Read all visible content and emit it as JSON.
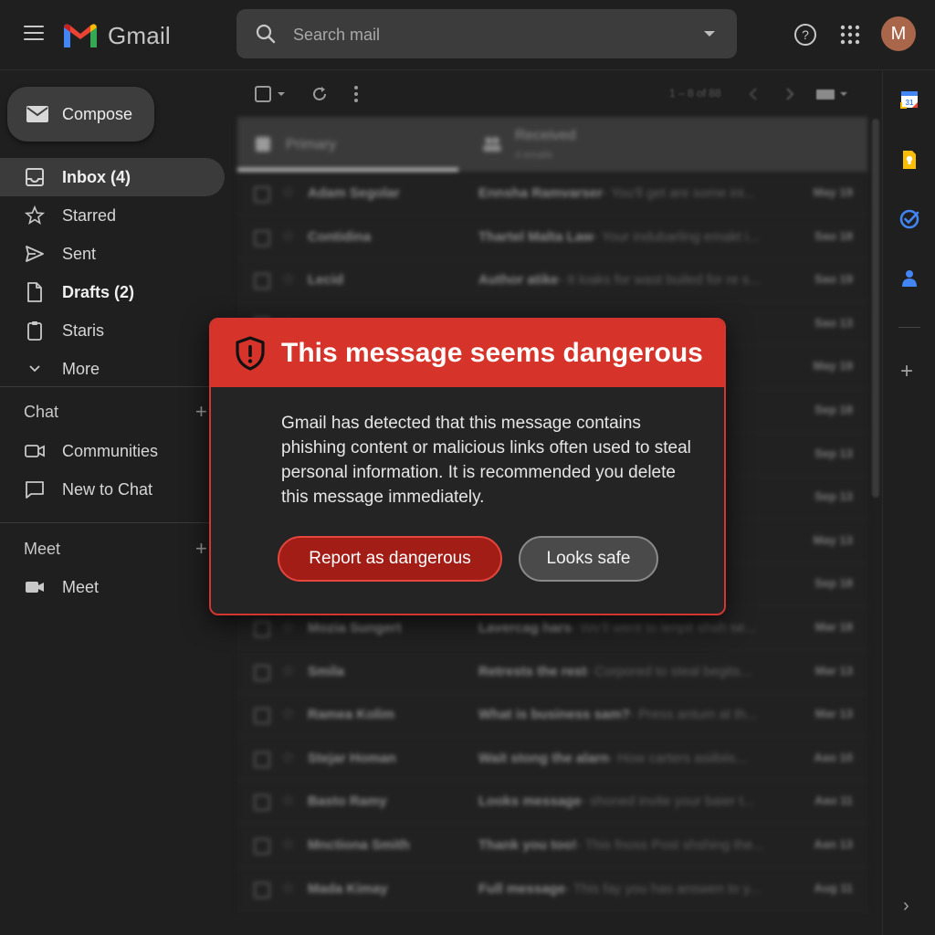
{
  "header": {
    "app_name": "Gmail",
    "search_placeholder": "Search mail",
    "avatar_initial": "M"
  },
  "sidebar": {
    "compose_label": "Compose",
    "items": [
      {
        "label": "Inbox (4)",
        "icon": "inbox-icon",
        "active": true,
        "bold": true
      },
      {
        "label": "Starred",
        "icon": "star-icon"
      },
      {
        "label": "Sent",
        "icon": "send-icon"
      },
      {
        "label": "Drafts (2)",
        "icon": "draft-icon",
        "bold": true
      },
      {
        "label": "Staris",
        "icon": "clipboard-icon"
      },
      {
        "label": "More",
        "icon": "chevron-down-icon"
      }
    ],
    "chat_title": "Chat",
    "chat_items": [
      {
        "label": "Communities",
        "icon": "video-icon"
      },
      {
        "label": "New to Chat",
        "icon": "chat-bubble-icon"
      }
    ],
    "meet_title": "Meet",
    "meet_items": [
      {
        "label": "Meet",
        "icon": "camera-icon"
      }
    ]
  },
  "toolbar": {
    "pager": "1 – 8 of 88"
  },
  "tabs": {
    "primary_label": "Primary",
    "received_label": "Received",
    "received_sub": "4 emails"
  },
  "emails": [
    {
      "sender": "Adam Segolar",
      "subject": "Ennsha Ramvarser",
      "snippet": " - You'll get are some ini...",
      "date": "May 19"
    },
    {
      "sender": "Contidina",
      "subject": "Thartel Malta Law",
      "snippet": " - Your indubarling emakt i...",
      "date": "Sao 18"
    },
    {
      "sender": "Lecid",
      "subject": "Author atike",
      "snippet": " - It loaks for wast builed for re s...",
      "date": "Sao 19"
    },
    {
      "sender": "",
      "subject": "",
      "snippet": "",
      "date": "Sao 13"
    },
    {
      "sender": "",
      "subject": "",
      "snippet": "",
      "date": "May 19"
    },
    {
      "sender": "",
      "subject": "",
      "snippet": "",
      "date": "Sep 18"
    },
    {
      "sender": "",
      "subject": "",
      "snippet": "",
      "date": "Sep 13"
    },
    {
      "sender": "",
      "subject": "",
      "snippet": "",
      "date": "Sep 13"
    },
    {
      "sender": "",
      "subject": "",
      "snippet": "",
      "date": "May 13"
    },
    {
      "sender": "",
      "subject": "",
      "snippet": "",
      "date": "Sep 18"
    },
    {
      "sender": "Mozia Sungert",
      "subject": "Lavercag hars",
      "snippet": " - We'll went to lenpit shsh se...",
      "date": "Mar 18"
    },
    {
      "sender": "Smila",
      "subject": "Retrests the rest",
      "snippet": " - Corpored to steal begits...",
      "date": "Mar 13"
    },
    {
      "sender": "Ramea Kolim",
      "subject": "What is business sam?",
      "snippet": " - Press antum at th...",
      "date": "Mar 13"
    },
    {
      "sender": "Stejar Homan",
      "subject": "Wait stong the alarn",
      "snippet": " - How carters asiibiis...",
      "date": "Aao 10"
    },
    {
      "sender": "Basto Ramy",
      "subject": "Looks message",
      "snippet": " - shoned invite your baier t...",
      "date": "Aao 11"
    },
    {
      "sender": "Mnctiona Smith",
      "subject": "Thank you too!",
      "snippet": " - This fnoss Post shshing the...",
      "date": "Aan 13"
    },
    {
      "sender": "Mada Kimay",
      "subject": "Full message",
      "snippet": " - This fay you has answen to y...",
      "date": "Aug 11"
    }
  ],
  "dialog": {
    "title": "This message seems dangerous",
    "body": "Gmail has detected that this message contains phishing content or malicious links often used to steal personal information. It is recommended you delete this message immediately.",
    "report_button": "Report as dangerous",
    "safe_button": "Looks safe"
  },
  "colors": {
    "danger_red": "#d6332a",
    "report_button_bg": "#a31d17",
    "background": "#1f1f1f"
  }
}
